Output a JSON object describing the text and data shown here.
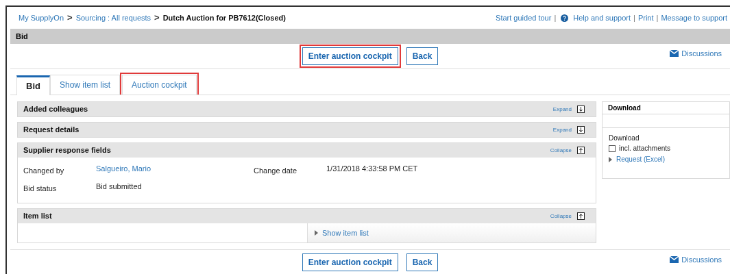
{
  "breadcrumb": [
    {
      "label": "My SupplyOn",
      "link": true
    },
    {
      "separator": ">",
      "label": "Sourcing : All requests",
      "link": true
    },
    {
      "separator": ">",
      "label": "Dutch Auction for PB7612(Closed)",
      "link": false
    }
  ],
  "top_links": [
    {
      "label": "Start guided tour"
    },
    {
      "separator": "|",
      "label": "Help and support"
    },
    {
      "separator": "|",
      "label": "Print"
    },
    {
      "separator": "|",
      "label": "Message to support"
    }
  ],
  "section_title": "Bid",
  "action_bar_top": {
    "buttons": [
      {
        "label": "Enter auction cockpit",
        "highlighted": true
      },
      {
        "label": "Back",
        "highlighted": false
      }
    ],
    "discussions": "Discussions"
  },
  "tabs": [
    {
      "label": "Bid",
      "selected": true,
      "highlighted": false
    },
    {
      "label": "Show item list",
      "selected": false,
      "highlighted": false
    },
    {
      "label": "Auction cockpit",
      "selected": false,
      "highlighted": true
    }
  ],
  "panels": [
    {
      "title": "Added colleagues",
      "expanded": false,
      "toggle": "Expand"
    },
    {
      "title": "Request details",
      "expanded": false,
      "toggle": "Expand"
    },
    {
      "title": "Supplier response fields",
      "expanded": true,
      "toggle": "Collapse",
      "kind": "fields",
      "fields": [
        {
          "label": "Changed by",
          "value": "Salgueiro, Mario",
          "link": true
        },
        {
          "label": "Bid status",
          "value": "Bid submitted",
          "link": false
        }
      ],
      "side_fields": [
        {
          "label": "Change date",
          "value": "1/31/2018 4:33:58 PM CET",
          "link": false
        }
      ]
    },
    {
      "title": "Item list",
      "expanded": true,
      "toggle": "Collapse",
      "kind": "items",
      "link": "Show item list"
    }
  ],
  "download": {
    "title": "Download",
    "label": "Download",
    "checkbox": {
      "label": "incl. attachments",
      "checked": false
    },
    "link": "Request (Excel)"
  },
  "action_bar_bottom": {
    "buttons": [
      {
        "label": "Enter auction cockpit",
        "highlighted": false
      },
      {
        "label": "Back",
        "highlighted": false
      }
    ],
    "discussions": "Discussions"
  }
}
